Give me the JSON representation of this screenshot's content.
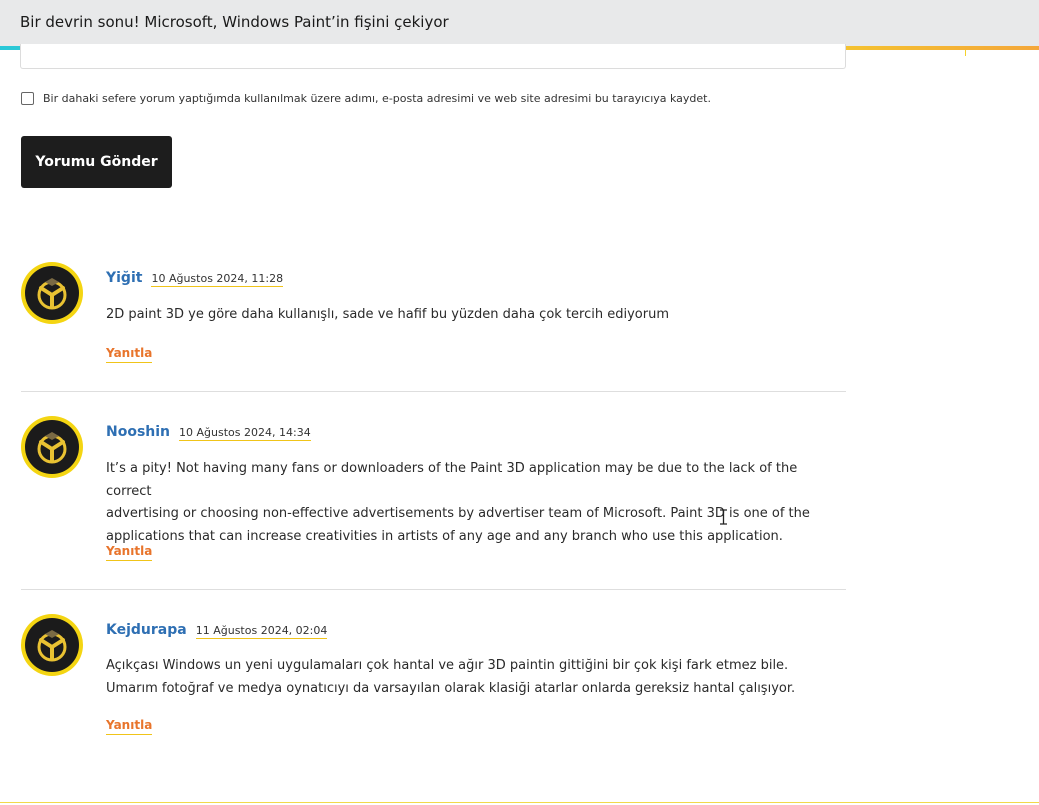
{
  "header": {
    "title": "Bir devrin sonu! Microsoft, Windows Paint’in fişini çekiyor"
  },
  "form": {
    "consent_label": "Bir dahaki sefere yorum yaptığımda kullanılmak üzere adımı, e-posta adresimi ve web site adresimi bu tarayıcıya kaydet.",
    "submit_label": "Yorumu Gönder"
  },
  "comments": [
    {
      "author": "Yiğit",
      "date": "10 Ağustos 2024, 11:28",
      "lines": [
        "2D paint 3D ye göre daha kullanışlı, sade ve hafif bu yüzden daha çok tercih ediyorum"
      ],
      "reply_label": "Yanıtla"
    },
    {
      "author": "Nooshin",
      "date": "10 Ağustos 2024, 14:34",
      "lines": [
        "It’s a pity! Not having many fans or downloaders of the Paint 3D application may be due to the lack of the correct",
        "advertising or choosing non-effective advertisements by advertiser team of Microsoft. Paint 3D is one of the",
        "applications that can increase creativities in artists of any age and any branch who use this application."
      ],
      "reply_label": "Yanıtla"
    },
    {
      "author": "Kejdurapa",
      "date": "11 Ağustos 2024, 02:04",
      "lines": [
        "Açıkçası Windows un yeni uygulamaları çok hantal ve ağır 3D paintin gittiğini bir çok kişi fark etmez bile.",
        "Umarım fotoğraf ve medya oynatıcıyı da varsayılan olarak klasiği atarlar onlarda gereksiz hantal çalışıyor."
      ],
      "reply_label": "Yanıtla"
    }
  ],
  "icons": {
    "avatar": "yellow-tripod-logo-icon",
    "cursor": "text-cursor-icon"
  },
  "colors": {
    "author": "#2e6fb3",
    "reply": "#e8742b",
    "avatar_ring": "#f4d512",
    "button": "#1d1d1d"
  }
}
